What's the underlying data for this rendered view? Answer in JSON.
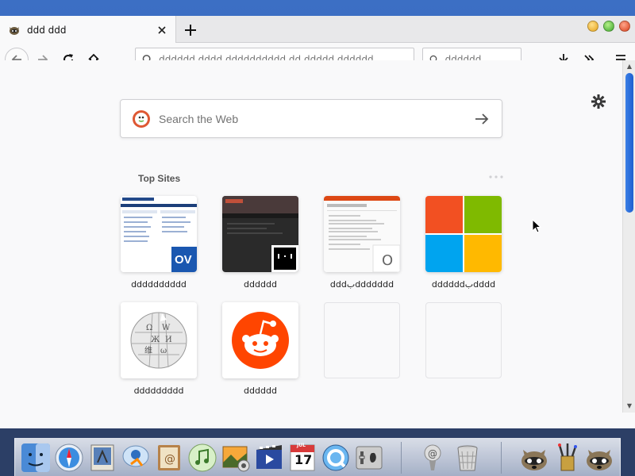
{
  "tab": {
    "title": "ddd ddd"
  },
  "navbar": {
    "url_placeholder": "dddddd dddd dddddddddd dd ddddd dddddd",
    "search_placeholder": "dddddd"
  },
  "newtab": {
    "search_placeholder": "Search the Web",
    "top_sites_label": "Top Sites",
    "tiles": [
      {
        "label": "dddddddddd",
        "tile": "oldversion"
      },
      {
        "label": "dddddd",
        "tile": "zone"
      },
      {
        "label": "dddبddddddd",
        "tile": "ubuntu-doc"
      },
      {
        "label": "ddddddبdddd",
        "tile": "microsoft"
      },
      {
        "label": "ddddddddd",
        "tile": "wikipedia"
      },
      {
        "label": "dddddd",
        "tile": "reddit"
      },
      {
        "label": "",
        "tile": "empty"
      },
      {
        "label": "",
        "tile": "empty"
      }
    ],
    "tile_badges": {
      "oldversion": "OV",
      "ubuntu-doc": "O"
    }
  },
  "colors": {
    "desktop": "#2a5aa8",
    "scroll_thumb": "#1d5fcf",
    "ddg": "#de5833",
    "reddit": "#ff4500",
    "ms_red": "#f25022",
    "ms_green": "#7fba00",
    "ms_blue": "#00a4ef",
    "ms_yellow": "#ffb900"
  },
  "dock": {
    "icons": [
      "finder-icon",
      "safari-icon",
      "preview-icon",
      "ichat-icon",
      "address-book-icon",
      "itunes-icon",
      "iphoto-icon",
      "imovie-icon",
      "ical-icon",
      "quicktime-icon",
      "system-prefs-icon",
      "mail-stamp-icon",
      "trash-icon",
      "raccoon-icon",
      "pencil-cup-icon",
      "raccoon-icon-2"
    ],
    "ical_date": "17",
    "ical_month": "JUL"
  }
}
